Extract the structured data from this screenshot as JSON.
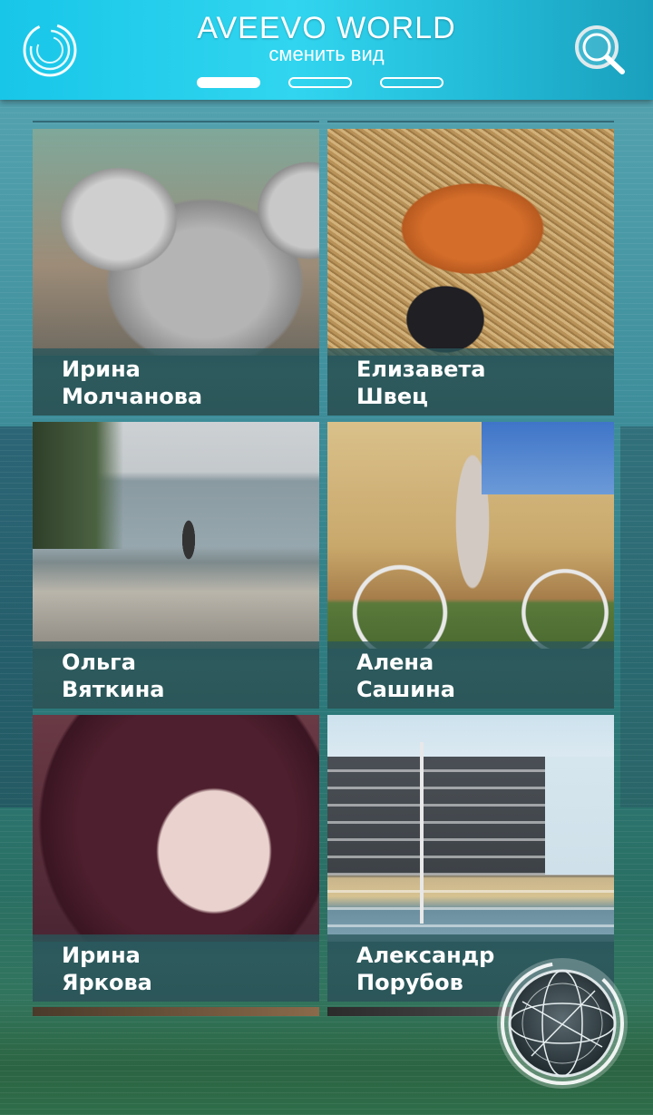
{
  "header": {
    "title": "AVEEVO WORLD",
    "subtitle": "сменить вид",
    "view_modes": [
      "grid",
      "list",
      "map"
    ],
    "active_view": 0
  },
  "icons": {
    "menu": "circular-menu-icon",
    "search": "search-icon",
    "globe": "globe-icon"
  },
  "users": [
    {
      "first_name": "Ирина",
      "last_name": "Молчанова",
      "photo": "koala"
    },
    {
      "first_name": "Елизавета",
      "last_name": "Швец",
      "photo": "fox"
    },
    {
      "first_name": "Ольга",
      "last_name": "Вяткина",
      "photo": "lake"
    },
    {
      "first_name": "Алена",
      "last_name": "Сашина",
      "photo": "bicycle"
    },
    {
      "first_name": "Ирина",
      "last_name": "Яркова",
      "photo": "portrait"
    },
    {
      "first_name": "Александр",
      "last_name": "Порубов",
      "photo": "building"
    }
  ],
  "colors": {
    "header": "#22c7e6",
    "caption_bg": "#2c5659",
    "text": "#ffffff"
  }
}
